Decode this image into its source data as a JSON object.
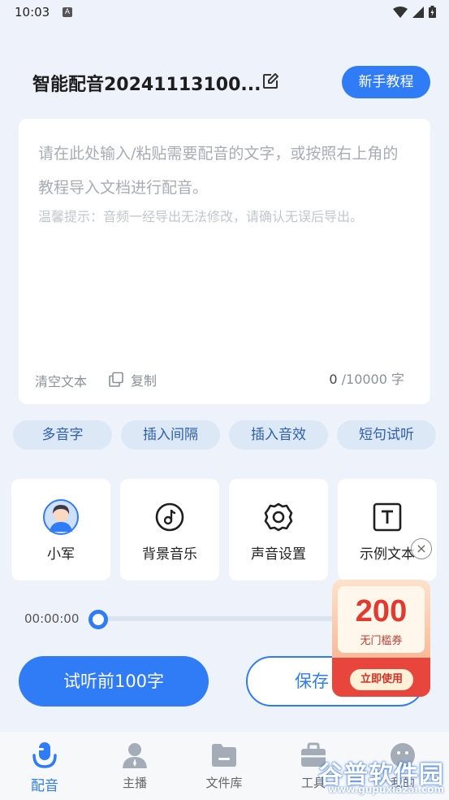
{
  "status_bar": {
    "time": "10:03",
    "notif": "A"
  },
  "header": {
    "title": "智能配音20241113100...",
    "tutorial_label": "新手教程"
  },
  "editor": {
    "placeholder": "请在此处输入/粘贴需要配音的文字，或按照右上角的教程导入文档进行配音。",
    "tip": "温馨提示：音频一经导出无法修改，请确认无误后导出。",
    "clear_label": "清空文本",
    "copy_label": "复制",
    "count_current": "0",
    "count_max": " /10000 字"
  },
  "chips": [
    "多音字",
    "插入间隔",
    "插入音效",
    "短句试听"
  ],
  "tools": [
    {
      "label": "小军",
      "icon": "voice-avatar-icon"
    },
    {
      "label": "背景音乐",
      "icon": "music-note-icon"
    },
    {
      "label": "声音设置",
      "icon": "gear-icon"
    },
    {
      "label": "示例文本",
      "icon": "text-t-icon"
    }
  ],
  "player": {
    "time": "00:00:00",
    "progress": 0
  },
  "actions": {
    "preview_label": "试听前100字",
    "save_label": "保存"
  },
  "coupon": {
    "amount": "200",
    "subtitle": "无门槛券",
    "button": "立即使用",
    "close": "×"
  },
  "nav": [
    {
      "label": "配音",
      "icon": "mic-icon",
      "active": true
    },
    {
      "label": "主播",
      "icon": "person-icon",
      "active": false
    },
    {
      "label": "文件库",
      "icon": "folder-icon",
      "active": false
    },
    {
      "label": "工具",
      "icon": "toolbox-icon",
      "active": false
    },
    {
      "label": "我的",
      "icon": "profile-icon",
      "active": false
    }
  ],
  "watermark": {
    "name": "谷普软件园",
    "url": "www.gupuxiazai.com"
  },
  "colors": {
    "accent": "#2f7cf6",
    "background": "#eef3fb",
    "coupon_red": "#e8463c"
  }
}
